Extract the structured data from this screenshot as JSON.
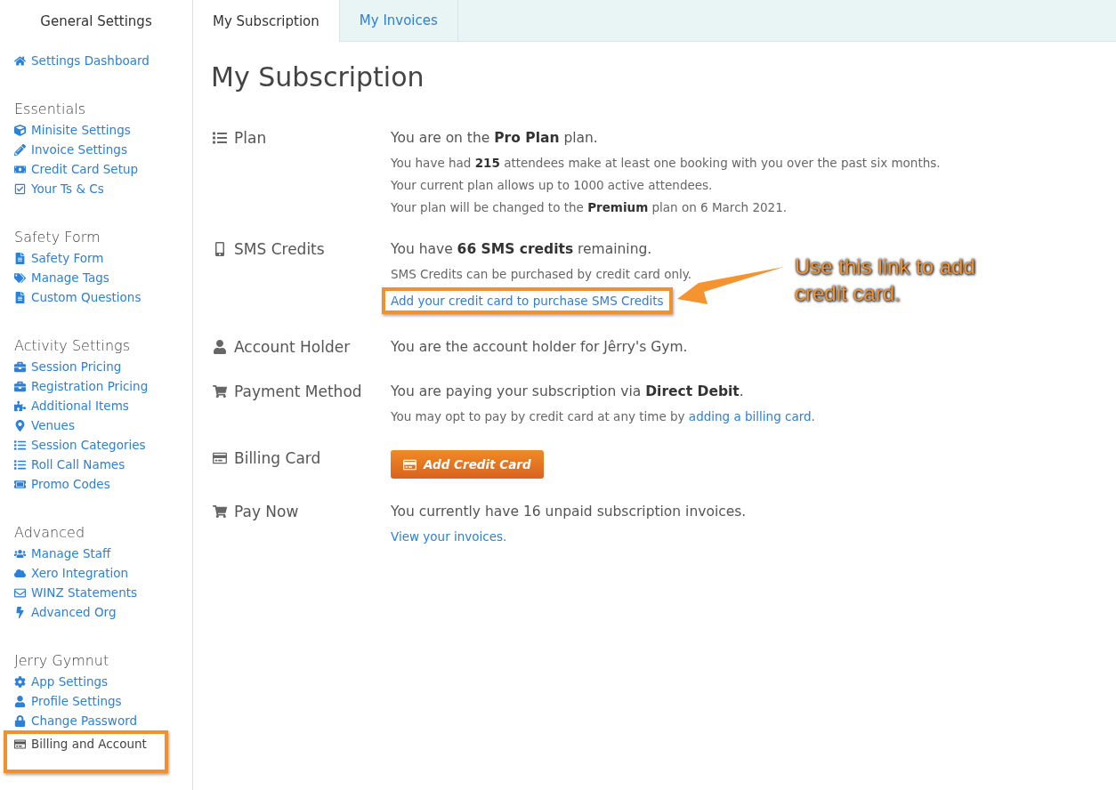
{
  "sidebar": {
    "title": "General Settings",
    "sections": [
      {
        "items": [
          {
            "label": "Settings Dashboard",
            "highlighted": false
          }
        ]
      },
      {
        "heading": "Essentials",
        "items": [
          {
            "label": "Minisite Settings",
            "highlighted": false
          },
          {
            "label": "Invoice Settings",
            "highlighted": false
          },
          {
            "label": "Credit Card Setup",
            "highlighted": false
          },
          {
            "label": "Your Ts & Cs",
            "highlighted": false
          }
        ]
      },
      {
        "heading": "Safety Form",
        "items": [
          {
            "label": "Safety Form",
            "highlighted": false
          },
          {
            "label": "Manage Tags",
            "highlighted": false
          },
          {
            "label": "Custom Questions",
            "highlighted": false
          }
        ]
      },
      {
        "heading": "Activity Settings",
        "items": [
          {
            "label": "Session Pricing",
            "highlighted": false
          },
          {
            "label": "Registration Pricing",
            "highlighted": false
          },
          {
            "label": "Additional Items",
            "highlighted": false
          },
          {
            "label": "Venues",
            "highlighted": false
          },
          {
            "label": "Session Categories",
            "highlighted": false
          },
          {
            "label": "Roll Call Names",
            "highlighted": false
          },
          {
            "label": "Promo Codes",
            "highlighted": false
          }
        ]
      },
      {
        "heading": "Advanced",
        "items": [
          {
            "label": "Manage Staff",
            "highlighted": false
          },
          {
            "label": "Xero Integration",
            "highlighted": false
          },
          {
            "label": "WINZ Statements",
            "highlighted": false
          },
          {
            "label": "Advanced Org",
            "highlighted": false
          }
        ]
      },
      {
        "heading": "Jerry Gymnut",
        "items": [
          {
            "label": "App Settings",
            "highlighted": false
          },
          {
            "label": "Profile Settings",
            "highlighted": false
          },
          {
            "label": "Change Password",
            "highlighted": false
          },
          {
            "label": "Billing and Account",
            "highlighted": true
          }
        ]
      }
    ]
  },
  "tabs": [
    {
      "label": "My Subscription",
      "selected": true
    },
    {
      "label": "My Invoices",
      "selected": false
    }
  ],
  "heading": "My Subscription",
  "rows": [
    {
      "label": "Plan",
      "lines": [
        {
          "kind": "lead",
          "text": "You are on the **Pro Plan** plan."
        },
        {
          "kind": "note",
          "text": "You have had **215** attendees make at least one booking with you over the past six months."
        },
        {
          "kind": "note",
          "text": "Your current plan allows up to 1000 active attendees."
        },
        {
          "kind": "note",
          "text": "Your plan will be changed to the **Premium** plan on 6 March 2021."
        }
      ]
    },
    {
      "label": "SMS Credits",
      "lines": [
        {
          "kind": "lead",
          "text": "You have **66 SMS credits** remaining."
        },
        {
          "kind": "note",
          "text": "SMS Credits can be purchased by credit card only."
        },
        {
          "kind": "link",
          "text": "Add your credit card to purchase SMS Credits",
          "highlighted": true
        }
      ]
    },
    {
      "label": "Account Holder",
      "lines": [
        {
          "kind": "lead",
          "text": "You are the account holder for Jêrry's Gym."
        }
      ]
    },
    {
      "label": "Payment Method",
      "lines": [
        {
          "kind": "lead",
          "text": "You are paying your subscription via **Direct Debit**."
        },
        {
          "kind": "note",
          "text": "You may opt to pay by credit card at any time by ",
          "link": "adding a billing card",
          "after": "."
        }
      ]
    },
    {
      "label": "Billing Card",
      "lines": [
        {
          "kind": "button",
          "text": "Add Credit Card"
        }
      ]
    },
    {
      "label": "Pay Now",
      "lines": [
        {
          "kind": "lead",
          "text": "You currently have 16 unpaid subscription invoices."
        },
        {
          "kind": "link",
          "text": "View your invoices.",
          "highlighted": false
        }
      ]
    }
  ],
  "callout": {
    "text": "Use this link to add credit card."
  }
}
